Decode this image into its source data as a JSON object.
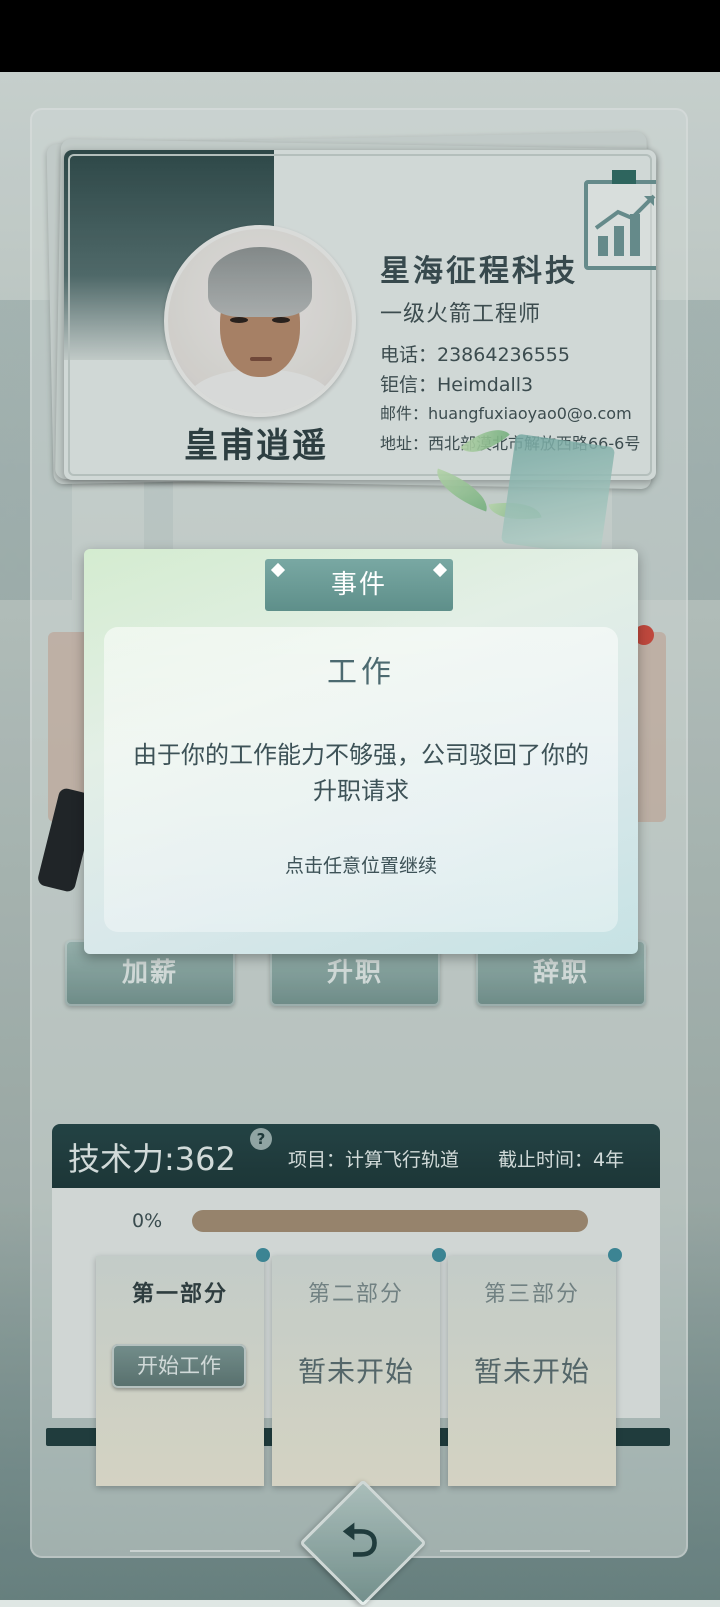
{
  "card": {
    "name": "皇甫逍遥",
    "company": "星海征程科技",
    "title": "一级火箭工程师",
    "phone": "电话：23864236555",
    "messenger": "钜信：Heimdall3",
    "email": "邮件：huangfuxiaoyao0@o.com",
    "address": "地址：西北部漠北市解放西路66-6号"
  },
  "actions": {
    "raise": "加薪",
    "promote": "升职",
    "resign": "辞职"
  },
  "event_dialog": {
    "tag": "事件",
    "heading": "工作",
    "message": "由于你的工作能力不够强，公司驳回了你的升职请求",
    "hint": "点击任意位置继续"
  },
  "tech": {
    "score": "技术力:362",
    "help": "?",
    "project": "项目：计算飞行轨道",
    "deadline": "截止时间：4年",
    "progress_label": "0%",
    "progress_fraction": 0
  },
  "parts": [
    {
      "title": "第一部分",
      "action": "开始工作"
    },
    {
      "title": "第二部分",
      "status": "暂未开始"
    },
    {
      "title": "第三部分",
      "status": "暂未开始"
    }
  ],
  "colors": {
    "accent": "#5e8f8a",
    "dark_teal": "#1f3d3e",
    "progress_track": "#a58e74"
  },
  "icons": {
    "back": "return-arrow-icon",
    "chart": "growth-chart-icon",
    "help": "question-icon"
  }
}
